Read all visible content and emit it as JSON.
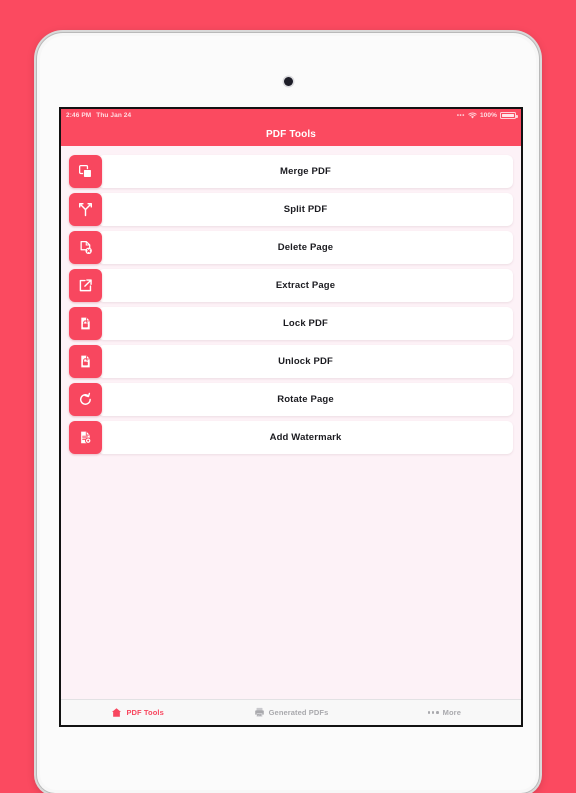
{
  "theme": {
    "backdrop_color": "#fb4a60",
    "accent_color": "#f8475f",
    "screen_background": "#fdf2f7",
    "card_background": "#ffffff",
    "tabbar_background": "#f8f8f8",
    "inactive_color": "#a9a9ad"
  },
  "device": {
    "camera_icon": "camera-dot"
  },
  "statusbar": {
    "time": "2:46 PM",
    "date": "Thu Jan 24",
    "signal_icon": "signal-dots",
    "signal_dots": "•••",
    "wifi_icon": "wifi-icon",
    "battery_percent": "100%",
    "battery_icon": "battery-full-icon"
  },
  "navbar": {
    "title": "PDF Tools"
  },
  "tools": [
    {
      "label": "Merge PDF",
      "icon": "merge-squares-icon"
    },
    {
      "label": "Split PDF",
      "icon": "split-branch-icon"
    },
    {
      "label": "Delete Page",
      "icon": "document-delete-icon"
    },
    {
      "label": "Extract Page",
      "icon": "export-share-icon"
    },
    {
      "label": "Lock PDF",
      "icon": "document-lock-icon"
    },
    {
      "label": "Unlock PDF",
      "icon": "document-unlock-icon"
    },
    {
      "label": "Rotate Page",
      "icon": "rotate-arrow-icon"
    },
    {
      "label": "Add Watermark",
      "icon": "document-watermark-icon"
    }
  ],
  "tabbar": {
    "tabs": [
      {
        "label": "PDF Tools",
        "icon": "home-icon",
        "active": true
      },
      {
        "label": "Generated PDFs",
        "icon": "pdf-file-icon",
        "active": false
      },
      {
        "label": "More",
        "icon": "ellipsis-icon",
        "active": false
      }
    ]
  }
}
